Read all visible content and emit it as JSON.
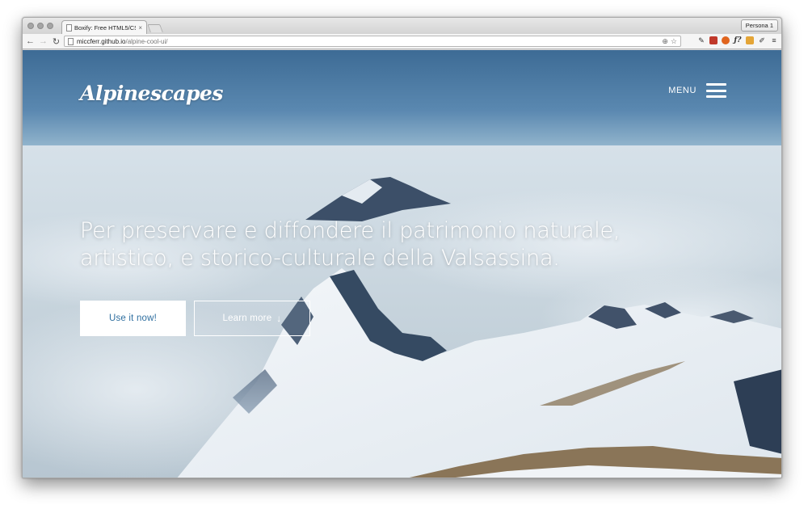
{
  "browser": {
    "tab_title": "Boxify: Free HTML5/CSS3",
    "tab_close": "×",
    "persona": "Persona 1",
    "url_host": "miccferr.github.io",
    "url_path": "/alpine-cool-ui/",
    "icons": {
      "back": "←",
      "forward": "→",
      "reload": "↻",
      "zoom": "⊕",
      "bookmark": "☆",
      "menu": "≡"
    }
  },
  "page": {
    "logo": "Alpinescapes",
    "menu_label": "MENU",
    "headline_line1": "Per preservare e diffondere il patrimonio naturale,",
    "headline_line2": "artistico, e storico-culturale della Valsassina.",
    "primary_button": "Use it now!",
    "secondary_button": "Learn more",
    "secondary_icon": "↓",
    "colors": {
      "primary_button_text": "#2f6fa0",
      "button_bg": "#ffffff",
      "sky_top": "#3d6b95"
    }
  }
}
